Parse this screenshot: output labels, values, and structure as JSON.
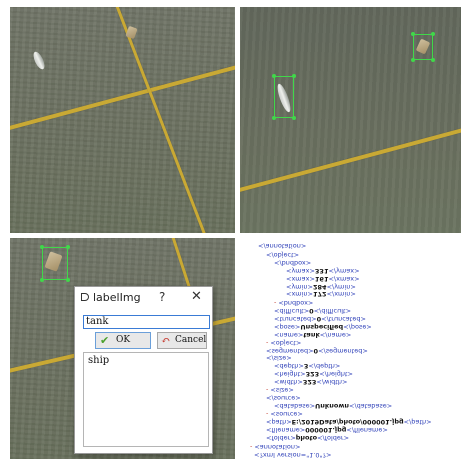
{
  "dialog": {
    "title": "labelImg",
    "help": "?",
    "close": "✕",
    "input_value": "tank",
    "ok_label": "OK",
    "ok_icon": "✔",
    "cancel_label": "Cancel",
    "cancel_icon": "↶",
    "list_items": [
      "ship"
    ]
  },
  "xml_lines": [
    {
      "m": "",
      "t": "</annotation>"
    },
    {
      "m": "",
      "t": "</object>"
    },
    {
      "m": "",
      "t": "</bndbox>"
    },
    {
      "m": "",
      "t": "<ymax>",
      "v": "331",
      "e": "</ymax>"
    },
    {
      "m": "",
      "t": "<xmax>",
      "v": "161",
      "e": "</xmax>"
    },
    {
      "m": "",
      "t": "<ymin>",
      "v": "284",
      "e": "</ymin>"
    },
    {
      "m": "",
      "t": "<xmin>",
      "v": "172",
      "e": "</xmin>"
    },
    {
      "m": "-",
      "t": "<bndbox>"
    },
    {
      "m": "",
      "t": "<difficult>",
      "v": "0",
      "e": "</difficult>"
    },
    {
      "m": "",
      "t": "<truncated>",
      "v": "0",
      "e": "</truncated>"
    },
    {
      "m": "",
      "t": "<pose>",
      "v": "Unspecified",
      "e": "</pose>"
    },
    {
      "m": "",
      "t": "<name>",
      "v": "tank",
      "e": "</name>"
    },
    {
      "m": "-",
      "t": "<object>"
    },
    {
      "m": "",
      "t": "<segmented>",
      "v": "0",
      "e": "</segmented>"
    },
    {
      "m": "",
      "t": "</size>"
    },
    {
      "m": "",
      "t": "<depth>",
      "v": "3",
      "e": "</depth>"
    },
    {
      "m": "",
      "t": "<height>",
      "v": "323",
      "e": "</height>"
    },
    {
      "m": "",
      "t": "<width>",
      "v": "323",
      "e": "</width>"
    },
    {
      "m": "-",
      "t": "<size>"
    },
    {
      "m": "",
      "t": "</source>"
    },
    {
      "m": "",
      "t": "<database>",
      "v": "Unknown",
      "e": "</database>"
    },
    {
      "m": "-",
      "t": "<source>"
    },
    {
      "m": "",
      "t": "<path>",
      "v": "E:/2019Data/photo/000001.jpg",
      "e": "</path>"
    },
    {
      "m": "",
      "t": "<filename>",
      "v": "000001.jpg",
      "e": "</filename>"
    },
    {
      "m": "",
      "t": "<folder>",
      "v": "photo",
      "e": "</folder>"
    },
    {
      "m": "-",
      "t": "<annotation>"
    },
    {
      "m": "",
      "t": "<?xml version=\"1.0\"?>"
    }
  ]
}
